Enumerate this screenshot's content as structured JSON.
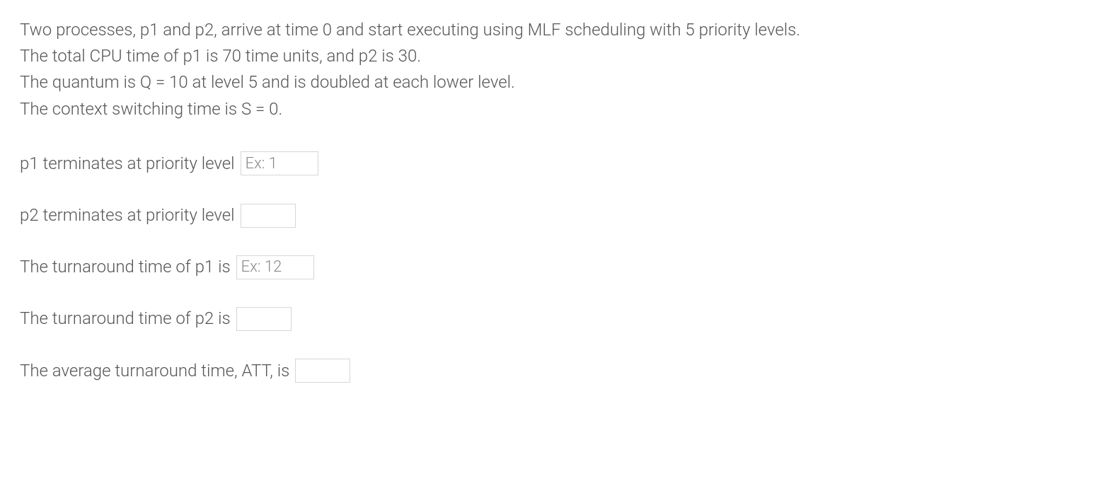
{
  "problem": {
    "line1": "Two processes, p1 and p2, arrive at time 0 and start executing using MLF scheduling with 5 priority levels.",
    "line2": "The total CPU time of p1 is 70 time units, and p2 is 30.",
    "line3": "The quantum is Q = 10 at level 5 and is doubled at each lower level.",
    "line4": "The context switching time is S = 0."
  },
  "questions": {
    "q1": {
      "label": "p1 terminates at priority level",
      "placeholder": "Ex: 1",
      "value": ""
    },
    "q2": {
      "label": "p2 terminates at priority level",
      "placeholder": "",
      "value": ""
    },
    "q3": {
      "label": "The turnaround time of p1 is",
      "placeholder": "Ex: 12",
      "value": ""
    },
    "q4": {
      "label": "The turnaround time of p2 is",
      "placeholder": "",
      "value": ""
    },
    "q5": {
      "label": "The average turnaround time, ATT, is",
      "placeholder": "",
      "value": ""
    }
  }
}
